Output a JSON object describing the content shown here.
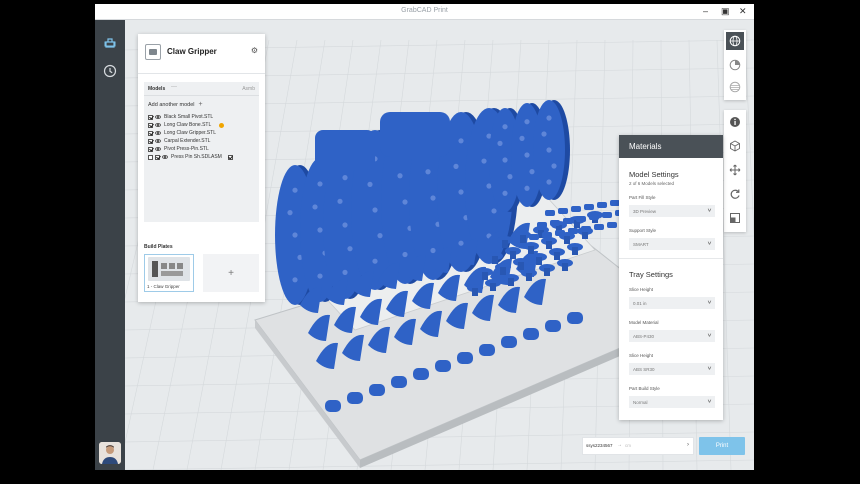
{
  "window": {
    "title": "GrabCAD Print",
    "minimize": "–",
    "maximize": "▣",
    "close": "✕"
  },
  "project": {
    "name": "Claw Gripper",
    "models_heading": "Models",
    "models_menu": "···",
    "assemblies_label": "Asmb",
    "add_model": "Add another model",
    "add_model_plus": "+",
    "models": [
      {
        "name": "Black Small Pivot.STL",
        "checked": true
      },
      {
        "name": "Long Claw Bone.STL",
        "checked": true,
        "warning": true
      },
      {
        "name": "Long Claw Gripper.STL",
        "checked": true
      },
      {
        "name": "Carpal Extender.STL",
        "checked": true
      },
      {
        "name": "Pivot Press-Pin.STL",
        "checked": true
      },
      {
        "name": "Press Pin Sh.SDLASM",
        "checked": false,
        "assembly": true
      }
    ],
    "build_plates_heading": "Build Plates",
    "plate_label": "1 - Claw Gripper",
    "add_plate": "+"
  },
  "materials": {
    "header": "Materials",
    "model_settings": "Model Settings",
    "models_selected": "2 of 6 Models selected",
    "part_fill_label": "Part Fill Style",
    "part_fill_value": "3D Preview",
    "support_label": "Support Style",
    "support_value": "SMART",
    "tray_settings": "Tray Settings",
    "slice_height_label": "Slice Height",
    "slice_height_value": "0.01 in",
    "model_material_label": "Model Material",
    "model_material_value": "ABS-P430",
    "slice_height2_label": "Slice Height",
    "slice_height2_value": "ABS SR30",
    "part_build_label": "Part Build Style",
    "part_build_value": "Normal"
  },
  "printbar": {
    "account": "ssys2234567",
    "arrow": "→",
    "placeholder": "cm",
    "go": "›",
    "print_label": "Print"
  },
  "colors": {
    "accent": "#7ec3ea",
    "model_blue": "#2f62c6",
    "panel_dark": "#4a5157",
    "rail": "#3b4248"
  },
  "icons": {
    "rail": [
      "printer-icon",
      "clock-icon"
    ],
    "toolbar": [
      "globe-view-icon",
      "printer-settings-icon",
      "layers-icon",
      "info-icon",
      "cube-icon",
      "move-icon",
      "rotate-icon",
      "scale-icon"
    ]
  }
}
